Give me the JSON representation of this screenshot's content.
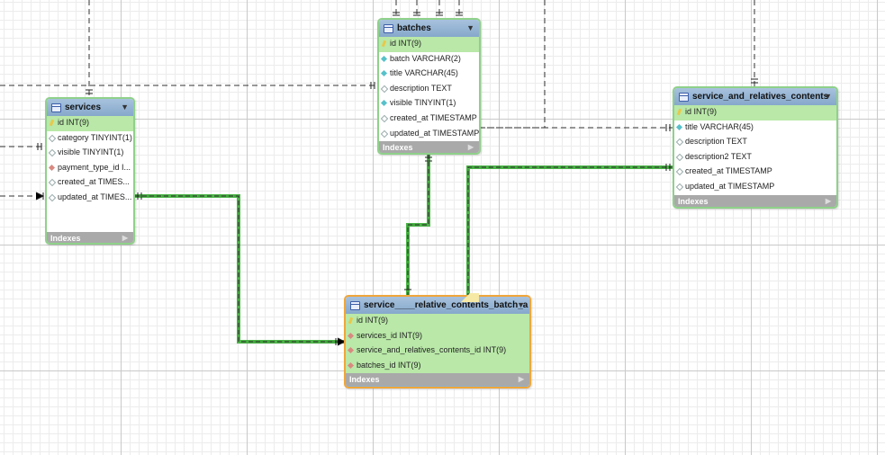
{
  "tables": {
    "services": {
      "name": "services",
      "columns": [
        {
          "text": "id INT(9)",
          "kind": "key"
        },
        {
          "text": "category TINYINT(1)",
          "kind": "plain"
        },
        {
          "text": "visible TINYINT(1)",
          "kind": "plain"
        },
        {
          "text": "payment_type_id I...",
          "kind": "fk"
        },
        {
          "text": "created_at TIMES...",
          "kind": "plain"
        },
        {
          "text": "updated_at TIMES...",
          "kind": "plain"
        }
      ],
      "indexes_label": "Indexes"
    },
    "batches": {
      "name": "batches",
      "columns": [
        {
          "text": "id INT(9)",
          "kind": "key"
        },
        {
          "text": "batch VARCHAR(2)",
          "kind": "nn"
        },
        {
          "text": "title VARCHAR(45)",
          "kind": "nn"
        },
        {
          "text": "description TEXT",
          "kind": "plain"
        },
        {
          "text": "visible TINYINT(1)",
          "kind": "nn"
        },
        {
          "text": "created_at TIMESTAMP",
          "kind": "plain"
        },
        {
          "text": "updated_at TIMESTAMP",
          "kind": "plain"
        }
      ],
      "indexes_label": "Indexes"
    },
    "contents": {
      "name": "service_and_relatives_contents",
      "columns": [
        {
          "text": "id INT(9)",
          "kind": "key"
        },
        {
          "text": "title VARCHAR(45)",
          "kind": "nn"
        },
        {
          "text": "description TEXT",
          "kind": "plain"
        },
        {
          "text": "description2 TEXT",
          "kind": "plain"
        },
        {
          "text": "created_at TIMESTAMP",
          "kind": "plain"
        },
        {
          "text": "updated_at TIMESTAMP",
          "kind": "plain"
        }
      ],
      "indexes_label": "Indexes"
    },
    "junction": {
      "name": "service____relative_contents_batch_a",
      "columns": [
        {
          "text": "id INT(9)",
          "kind": "key"
        },
        {
          "text": "services_id INT(9)",
          "kind": "fk"
        },
        {
          "text": "service_and_relatives_contents_id INT(9)",
          "kind": "fk"
        },
        {
          "text": "batches_id INT(9)",
          "kind": "fk"
        }
      ],
      "indexes_label": "Indexes"
    }
  },
  "toggle_glyph": "▼",
  "indexes_glyph": "▶",
  "colors": {
    "highlight_line": "#2fa82a",
    "dashed_line": "#333333",
    "table_border": "#8fd18a",
    "selected_border": "#f0a63a"
  }
}
